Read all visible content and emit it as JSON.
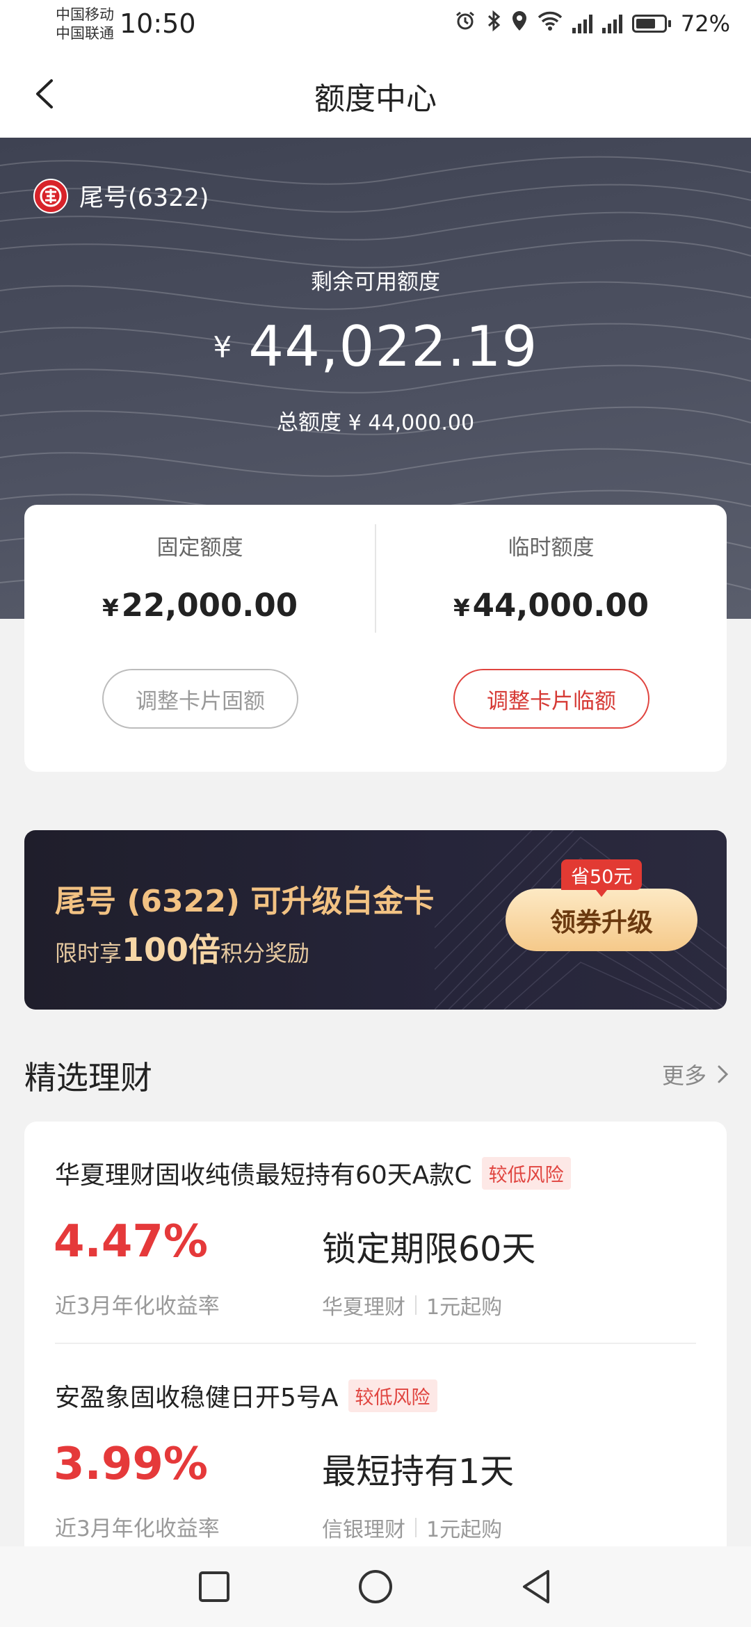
{
  "status_bar": {
    "carrier1": "中国移动",
    "carrier2": "中国联通",
    "time": "10:50",
    "battery_percent": "72%",
    "battery_level": 0.72,
    "icons": [
      "alarm-icon",
      "bluetooth-icon",
      "location-icon",
      "wifi-icon",
      "signal-4g-icon",
      "signal-4g-icon",
      "battery-icon"
    ]
  },
  "header": {
    "title": "额度中心",
    "back_icon": "chevron-left-icon"
  },
  "card": {
    "bank_logo": "citic-bank-logo",
    "card_suffix": "尾号(6322)",
    "remaining_label": "剩余可用额度",
    "remaining_currency": "¥",
    "remaining_amount": "44,022.19",
    "total_label": "总额度",
    "total_amount": "¥ 44,000.00"
  },
  "quota": {
    "fixed_label": "固定额度",
    "fixed_currency": "¥",
    "fixed_amount": "22,000.00",
    "fixed_button": "调整卡片固额",
    "temp_label": "临时额度",
    "temp_currency": "¥",
    "temp_amount": "44,000.00",
    "temp_button": "调整卡片临额"
  },
  "banner": {
    "title": "尾号 (6322) 可升级白金卡",
    "sub_prefix": "限时享",
    "sub_big": "100倍",
    "sub_suffix": "积分奖励",
    "tag": "省50元",
    "button": "领券升级"
  },
  "section": {
    "title": "精选理财",
    "more": "更多"
  },
  "products": [
    {
      "name": "华夏理财固收纯债最短持有60天A款C",
      "risk": "较低风险",
      "rate": "4.47%",
      "rate_label": "近3月年化收益率",
      "term": "锁定期限60天",
      "issuer": "华夏理财",
      "min": "1元起购"
    },
    {
      "name": "安盈象固收稳健日开5号A",
      "risk": "较低风险",
      "rate": "3.99%",
      "rate_label": "近3月年化收益率",
      "term": "最短持有1天",
      "issuer": "信银理财",
      "min": "1元起购"
    }
  ],
  "colors": {
    "accent_red": "#e5393a",
    "hero_bg": "#4a4e5e",
    "banner_gold": "#f2c283"
  }
}
